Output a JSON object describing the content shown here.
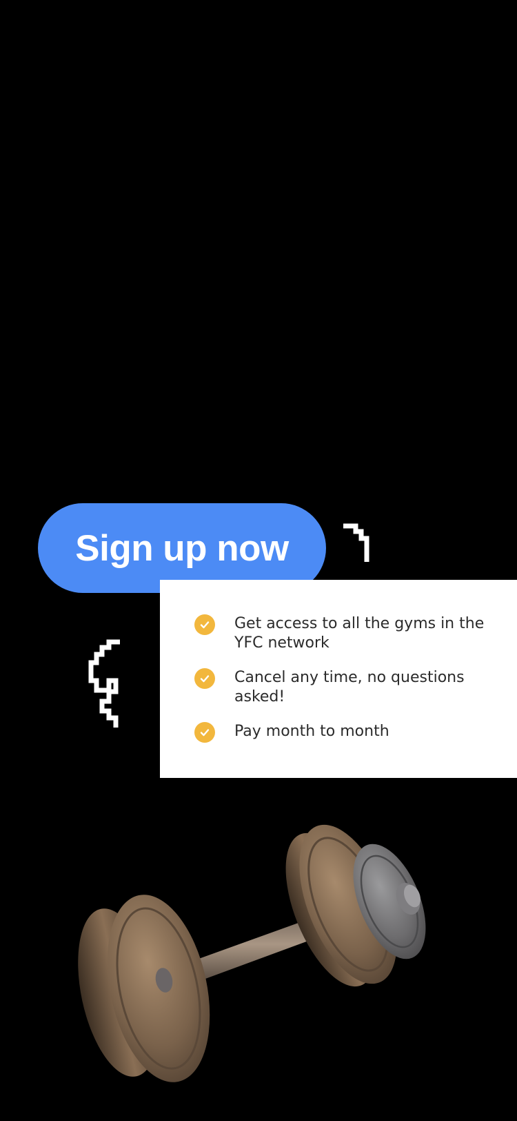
{
  "cta": {
    "label": "Sign up now"
  },
  "features": [
    {
      "text": "Get access to all the gyms in the YFC network"
    },
    {
      "text": "Cancel any time, no questions asked!"
    },
    {
      "text": "Pay month to month"
    }
  ],
  "colors": {
    "background": "#000000",
    "button": "#4c8bf5",
    "card": "#ffffff",
    "check": "#f2b73d",
    "text": "#2b2b2b"
  },
  "icons": [
    "decorative-bracket-icon",
    "decorative-squiggle-icon",
    "check-circle-icon",
    "dumbbell-icon"
  ]
}
